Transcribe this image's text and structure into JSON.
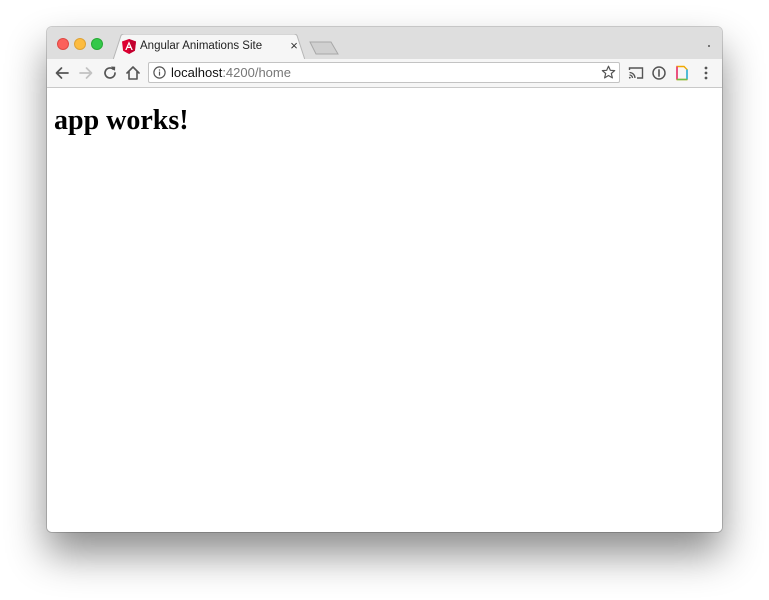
{
  "browser": {
    "tab": {
      "title": "Angular Animations Site",
      "favicon": "angular-icon",
      "close_symbol": "×"
    },
    "address_bar": {
      "host": "localhost",
      "path": ":4200/home"
    },
    "colors": {
      "close": "#fc605b",
      "minimize": "#fdbc40",
      "zoom": "#34c84a",
      "angular_red": "#dd0031"
    }
  },
  "page": {
    "heading": "app works!"
  }
}
